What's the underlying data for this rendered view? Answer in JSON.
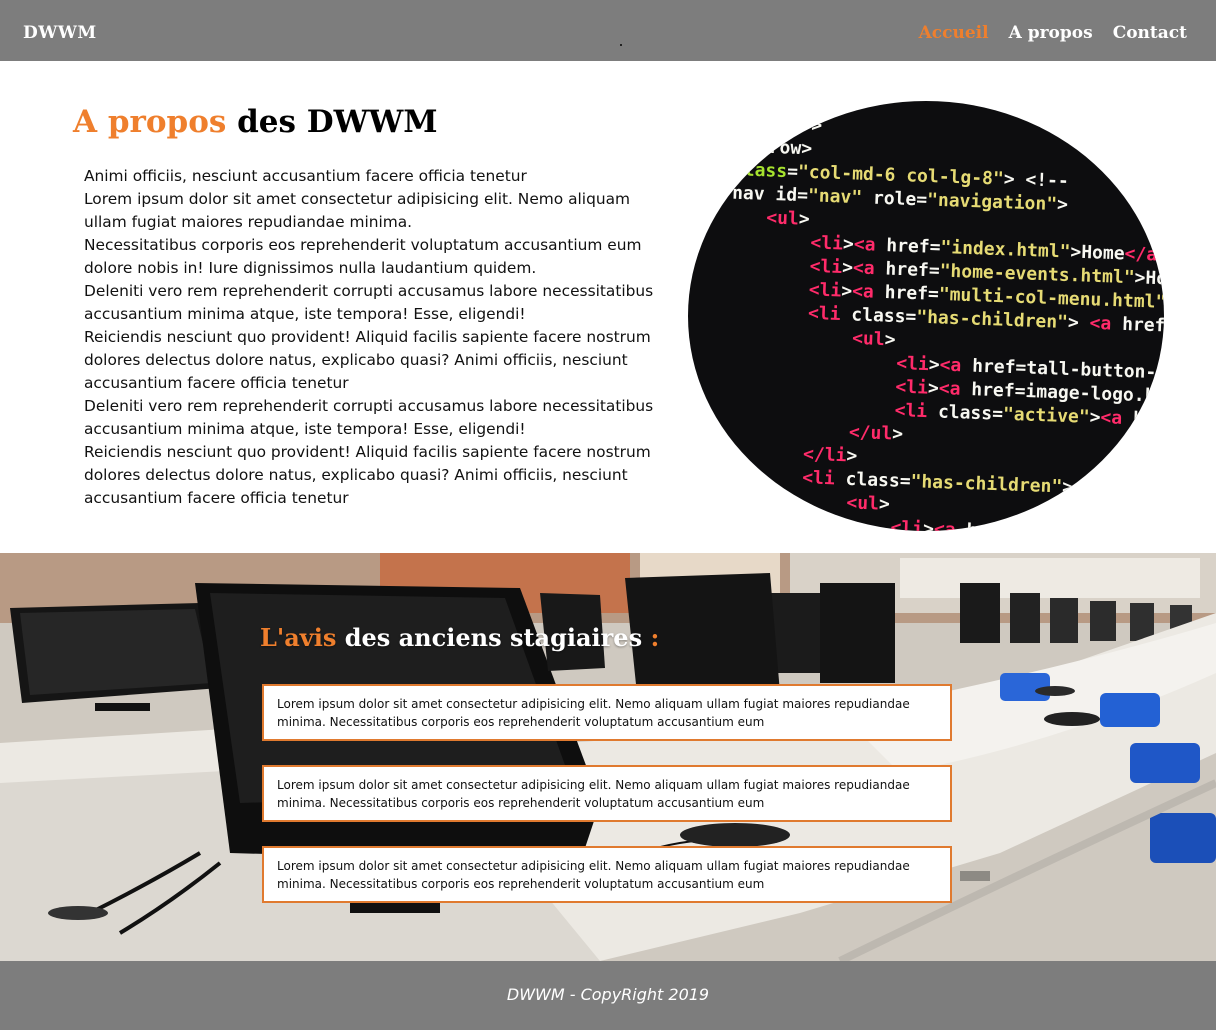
{
  "header": {
    "brand": "DWWM",
    "nav": [
      {
        "label": "Accueil",
        "active": true
      },
      {
        "label": "A propos",
        "active": false
      },
      {
        "label": "Contact",
        "active": false
      }
    ]
  },
  "about": {
    "title_highlight": "A propos",
    "title_rest": " des DWWM",
    "paragraph": "Animi officiis, nesciunt accusantium facere officia tenetur\nLorem ipsum dolor sit amet consectetur adipisicing elit. Nemo aliquam ullam fugiat maiores repudiandae minima.\nNecessitatibus corporis eos reprehenderit voluptatum accusantium eum dolore nobis in! Iure dignissimos nulla laudantium quidem.\nDeleniti vero rem reprehenderit corrupti accusamus labore necessitatibus accusantium minima atque, iste tempora! Esse, eligendi!\n Reiciendis nesciunt quo provident! Aliquid facilis sapiente facere nostrum dolores delectus dolore natus, explicabo quasi? Animi officiis, nesciunt accusantium facere officia tenetur\nDeleniti vero rem reprehenderit corrupti accusamus labore necessitatibus accusantium minima atque, iste tempora! Esse, eligendi!\n Reiciendis nesciunt quo provident! Aliquid facilis sapiente facere nostrum dolores delectus dolore natus, explicabo quasi? Animi officiis, nesciunt accusantium facere officia tenetur",
    "code_lines": [
      "er\">",
      "row\">",
      "class=\"col-md-6 col-lg-8\"> <!--",
      "nav id=\"nav\" role=\"navigation\">",
      "<ul>",
      "<li><a href=\"index.html\">Home</a",
      "<li><a href=\"home-events.html\">Hom",
      "<li><a href=\"multi-col-menu.html\">",
      "<li class=\"has-children\"> <a href=",
      "<ul>",
      "<li><a href=\"tall-button-h",
      "<li><a href=\"image-logo.ht",
      "<li class=\"active\"><a hre",
      "</ul>",
      "</li>",
      "<li class=\"has-children\"> <a href=",
      "<ul>",
      "<li><a href="
    ]
  },
  "reviews": {
    "title_highlight": "L'avis",
    "title_rest": " des anciens stagiaires ",
    "title_colon": ":",
    "items": [
      "Lorem ipsum dolor sit amet consectetur adipisicing elit. Nemo aliquam ullam fugiat maiores repudiandae minima.  Necessitatibus corporis eos reprehenderit voluptatum accusantium eum",
      "Lorem ipsum dolor sit amet consectetur adipisicing elit. Nemo aliquam ullam fugiat maiores repudiandae minima.  Necessitatibus corporis eos reprehenderit voluptatum accusantium eum",
      "Lorem ipsum dolor sit amet consectetur adipisicing elit. Nemo aliquam ullam fugiat maiores repudiandae minima.  Necessitatibus corporis eos reprehenderit voluptatum accusantium eum"
    ]
  },
  "footer": {
    "copyright": "DWWM - CopyRight 2019"
  },
  "colors": {
    "accent": "#ef7f2d",
    "header_bg": "#7d7d7d",
    "box_border": "#e07a2f"
  }
}
